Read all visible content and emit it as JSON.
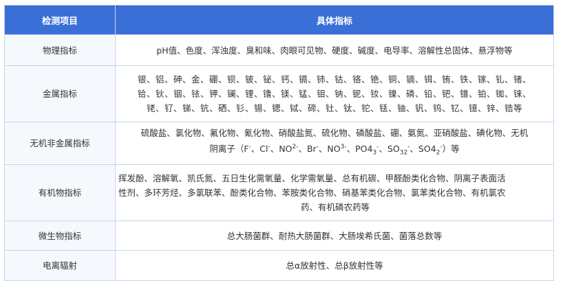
{
  "header": {
    "col1": "检测项目",
    "col2": "具体指标"
  },
  "rows": [
    {
      "category": "物理指标",
      "items": "pH值、色度、浑浊度、臭和味、肉眼可见物、硬度、碱度、电导率、溶解性总固体、悬浮物等"
    },
    {
      "category": "金属指标",
      "line1": "银、铝、砷、金、硼、钡、铍、铋、钙、镉、铈、钴、铬、铯、铜、镝、铒、铕、铁、镓、钆、锗、",
      "line2": "铪、钬、铟、铱、钾、镧、锂、镥、镁、锰、钼、钠、铌、钕、镍、磷、铅、钯、镨、铂、铷、铼、",
      "line3": "铑、钌、锑、钪、硒、钐、锡、锶、铽、碲、钍、钛、铊、铥、铀、钒、钨、钇、镱、锌、锆等"
    },
    {
      "category": "无机非金属指标",
      "line1": "硫酸盐、氯化物、氟化物、氰化物、硝酸盐氮、硫化物、磷酸盐、硼、氨氮、亚硝酸盐、碘化物、无机",
      "line2_prefix": "阴离子（F",
      "line2_sep1": "、Cl",
      "line2_sep2": "、NO",
      "line2_sep3": "、Br",
      "line2_sep4": "、NO",
      "line2_sep5": "、PO4",
      "line2_sep6": "、SO",
      "line2_sep7": "、SO4",
      "line2_suffix": "）等",
      "charge": "-",
      "sub2": "2",
      "sub3": "3"
    },
    {
      "category": "有机物指标",
      "line1": "挥发酚、溶解氧、凯氏氮、五日生化需氧量、化学需氧量、总有机碳、甲醛酚类化合物、阴离子表面活",
      "line2": "性剂、多环芳烃、多氯联苯、酚类化合物、苯胺类化合物、硝基苯类化合物、氯苯类化合物、有机氯农",
      "line3": "药、有机磷农药等"
    },
    {
      "category": "微生物指标",
      "items": "总大肠菌群、耐热大肠菌群、大肠埃希氏菌、菌落总数等"
    },
    {
      "category": "电离辐射",
      "items": "总α放射性、总β放射性等"
    }
  ],
  "colors": {
    "header_bg": "#3a6fd8",
    "border": "#c9d4ea",
    "text": "#333333"
  }
}
